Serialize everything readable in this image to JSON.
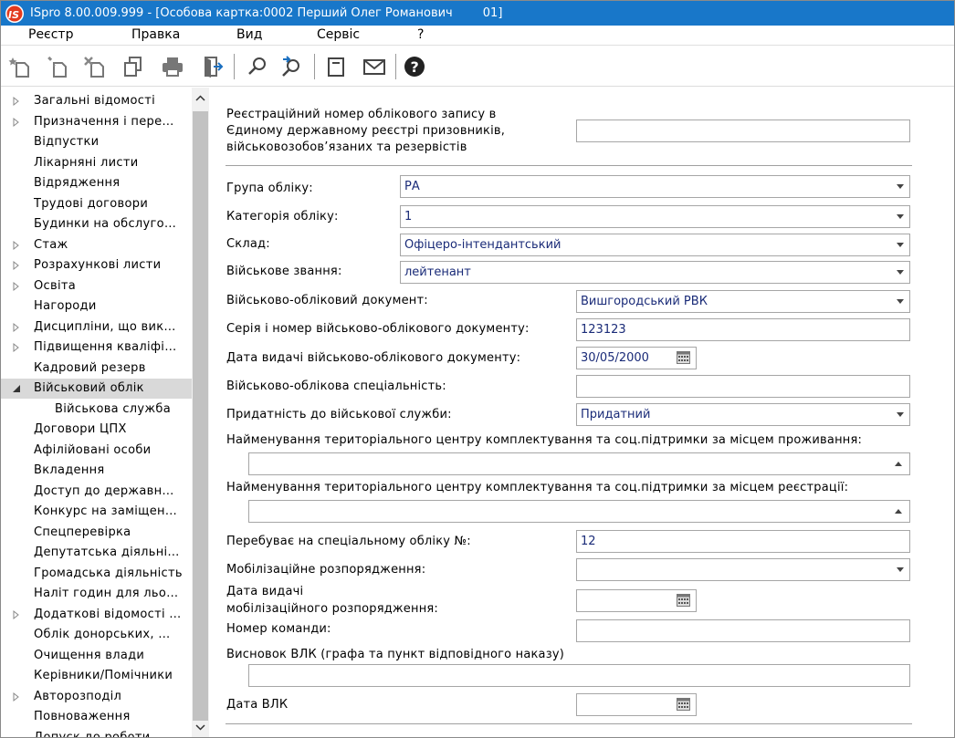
{
  "window": {
    "title": "ISpro 8.00.009.999 - [Особова картка:0002 Перший Олег Романович        01]"
  },
  "menu": [
    "Реєстр",
    "Правка",
    "Вид",
    "Сервіс",
    "?"
  ],
  "toolbar": {
    "icons": [
      "new-icon",
      "edit-icon",
      "delete-icon",
      "copy-icon",
      "print-icon",
      "exit-icon",
      "search-icon",
      "search-next-icon",
      "document-icon",
      "mail-icon",
      "help-icon"
    ]
  },
  "sidebar": {
    "items": [
      {
        "label": "Загальні відомості",
        "expandable": true
      },
      {
        "label": "Призначення і пере…",
        "expandable": true
      },
      {
        "label": "Відпустки"
      },
      {
        "label": "Лікарняні листи"
      },
      {
        "label": "Відрядження"
      },
      {
        "label": "Трудові договори"
      },
      {
        "label": "Будинки на обслуго…"
      },
      {
        "label": "Стаж",
        "expandable": true
      },
      {
        "label": "Розрахункові листи",
        "expandable": true
      },
      {
        "label": "Освіта",
        "expandable": true
      },
      {
        "label": "Нагороди"
      },
      {
        "label": "Дисципліни, що вик…",
        "expandable": true
      },
      {
        "label": "Підвищення кваліфі…",
        "expandable": true
      },
      {
        "label": "Кадровий резерв"
      },
      {
        "label": "Військовий облік",
        "expanded": true,
        "selected": true
      },
      {
        "label": "Військова служба",
        "sub": true
      },
      {
        "label": "Договори ЦПХ"
      },
      {
        "label": "Афілійовані особи"
      },
      {
        "label": "Вкладення"
      },
      {
        "label": "Доступ до державн…"
      },
      {
        "label": "Конкурс на заміщен…"
      },
      {
        "label": "Спецперевірка"
      },
      {
        "label": "Депутатська діяльні…"
      },
      {
        "label": "Громадська діяльність"
      },
      {
        "label": "Наліт годин для льо…"
      },
      {
        "label": "Додаткові відомості …",
        "expandable": true
      },
      {
        "label": "Облік донорських, …"
      },
      {
        "label": "Очищення влади"
      },
      {
        "label": "Керівники/Помічники"
      },
      {
        "label": "Авторозподіл",
        "expandable": true
      },
      {
        "label": "Повноваження"
      },
      {
        "label": "Допуск до роботи"
      }
    ]
  },
  "form": {
    "reg_label": [
      "Реєстраційний номер облікового запису в",
      "Єдиному державному реєстрі призовників,",
      "військовозобов’язаних та резервістів"
    ],
    "reg_value": "",
    "group_label": "Група обліку:",
    "group_value": "РА",
    "category_label": "Категорія обліку:",
    "category_value": "1",
    "staff_label": "Склад:",
    "staff_value": "Офіцеро-інтендантський",
    "rank_label": "Військове звання:",
    "rank_value": "лейтенант",
    "doc_label": "Військово-обліковий документ:",
    "doc_value": "Вишгородський РВК",
    "doc_series_label": "Серія і номер військово-облікового документу:",
    "doc_series_value": "123123",
    "doc_date_label": "Дата видачі військово-облікового документу:",
    "doc_date_value": "30/05/2000",
    "specialty_label": "Військово-облікова спеціальність:",
    "specialty_value": "",
    "fitness_label": "Придатність до військової служби:",
    "fitness_value": "Придатний",
    "tcc_residence_label": "Найменування територіального центру комплектування та соц.підтримки за місцем проживання:",
    "tcc_residence_value": "",
    "tcc_registration_label": "Найменування територіального центру комплектування та соц.підтримки за місцем реєстрації:",
    "tcc_registration_value": "",
    "special_label": "Перебуває на спеціальному обліку №:",
    "special_value": "12",
    "mob_label": "Мобілізаційне розпорядження:",
    "mob_value": "",
    "mob_date_label": [
      "Дата видачі",
      "мобілізаційного розпорядження:"
    ],
    "mob_date_value": "",
    "team_label": "Номер команди:",
    "team_value": "",
    "vlk_label": "Висновок ВЛК (графа та пункт відповідного наказу)",
    "vlk_value": "",
    "vlk_date_label": "Дата ВЛК",
    "vlk_date_value": ""
  },
  "colors": {
    "titlebar": "#1877c9",
    "field_text": "#1a2b78",
    "selected_row": "#d9d9d9"
  }
}
